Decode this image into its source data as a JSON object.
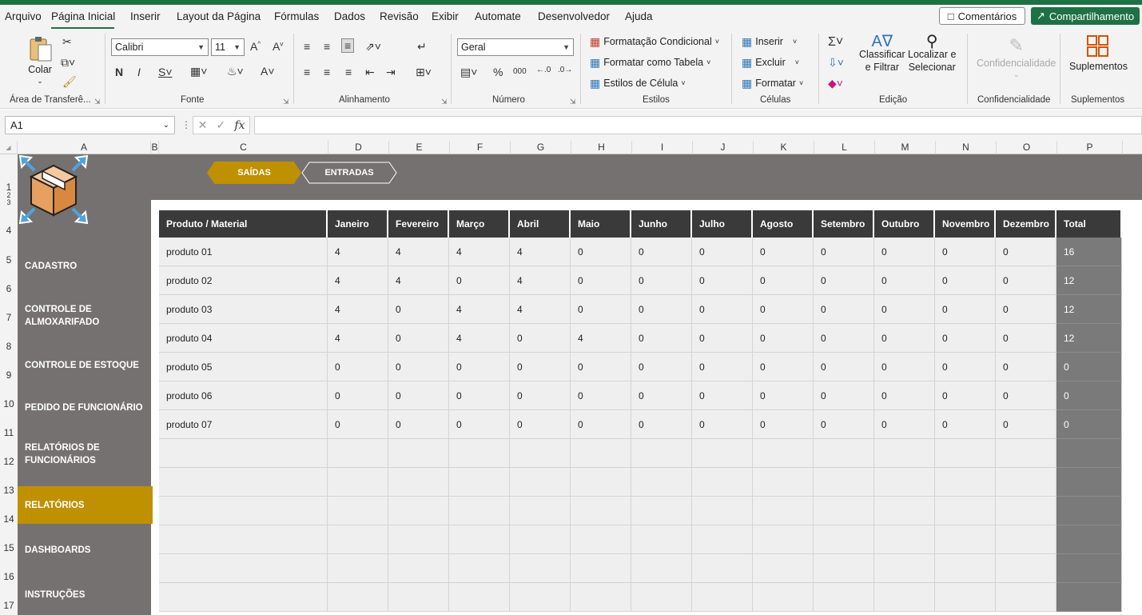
{
  "menu": {
    "items": [
      "Arquivo",
      "Página Inicial",
      "Inserir",
      "Layout da Página",
      "Fórmulas",
      "Dados",
      "Revisão",
      "Exibir",
      "Automate",
      "Desenvolvedor",
      "Ajuda"
    ],
    "comments": "Comentários",
    "share": "Compartilhamento"
  },
  "ribbon": {
    "clipboard": {
      "paste": "Colar",
      "group": "Área de Transferê..."
    },
    "font": {
      "name": "Calibri",
      "size": "11",
      "group": "Fonte"
    },
    "alignment": {
      "group": "Alinhamento"
    },
    "number": {
      "format": "Geral",
      "group": "Número"
    },
    "styles": {
      "cond_format": "Formatação Condicional",
      "format_table": "Formatar como Tabela",
      "cell_styles": "Estilos de Célula",
      "group": "Estilos"
    },
    "cells": {
      "insert": "Inserir",
      "delete": "Excluir",
      "format": "Formatar",
      "group": "Células"
    },
    "editing": {
      "sort_line1": "Classificar",
      "sort_line2": "e Filtrar",
      "find_line1": "Localizar e",
      "find_line2": "Selecionar",
      "group": "Edição"
    },
    "sensitivity": {
      "label": "Confidencialidade",
      "group": "Confidencialidade"
    },
    "addins": {
      "label": "Suplementos",
      "group": "Suplementos"
    }
  },
  "formula_bar": {
    "name_box": "A1",
    "fx": "fx",
    "formula": ""
  },
  "columns": [
    "A",
    "B",
    "C",
    "D",
    "E",
    "F",
    "G",
    "H",
    "I",
    "J",
    "K",
    "L",
    "M",
    "N",
    "O",
    "P"
  ],
  "rows": [
    "1",
    "2",
    "3",
    "4",
    "5",
    "6",
    "7",
    "8",
    "9",
    "10",
    "11",
    "12",
    "13",
    "14",
    "15",
    "16",
    "17"
  ],
  "tabs": {
    "outputs": "SAÍDAS",
    "inputs": "ENTRADAS"
  },
  "sidebar": {
    "items": [
      "CADASTRO",
      "CONTROLE DE ALMOXARIFADO",
      "CONTROLE DE ESTOQUE",
      "PEDIDO DE FUNCIONÁRIO",
      "RELATÓRIOS DE FUNCIONÁRIOS",
      "RELATÓRIOS",
      "DASHBOARDS",
      "INSTRUÇÕES"
    ],
    "active": "RELATÓRIOS"
  },
  "table": {
    "headers": [
      "Produto / Material",
      "Janeiro",
      "Fevereiro",
      "Março",
      "Abril",
      "Maio",
      "Junho",
      "Julho",
      "Agosto",
      "Setembro",
      "Outubro",
      "Novembro",
      "Dezembro",
      "Total"
    ],
    "rows": [
      [
        "produto 01",
        "4",
        "4",
        "4",
        "4",
        "0",
        "0",
        "0",
        "0",
        "0",
        "0",
        "0",
        "0",
        "16"
      ],
      [
        "produto 02",
        "4",
        "4",
        "0",
        "4",
        "0",
        "0",
        "0",
        "0",
        "0",
        "0",
        "0",
        "0",
        "12"
      ],
      [
        "produto 03",
        "4",
        "0",
        "4",
        "4",
        "0",
        "0",
        "0",
        "0",
        "0",
        "0",
        "0",
        "0",
        "12"
      ],
      [
        "produto 04",
        "4",
        "0",
        "4",
        "0",
        "4",
        "0",
        "0",
        "0",
        "0",
        "0",
        "0",
        "0",
        "12"
      ],
      [
        "produto 05",
        "0",
        "0",
        "0",
        "0",
        "0",
        "0",
        "0",
        "0",
        "0",
        "0",
        "0",
        "0",
        "0"
      ],
      [
        "produto 06",
        "0",
        "0",
        "0",
        "0",
        "0",
        "0",
        "0",
        "0",
        "0",
        "0",
        "0",
        "0",
        "0"
      ],
      [
        "produto 07",
        "0",
        "0",
        "0",
        "0",
        "0",
        "0",
        "0",
        "0",
        "0",
        "0",
        "0",
        "0",
        "0"
      ],
      [
        "",
        "",
        "",
        "",
        "",
        "",
        "",
        "",
        "",
        "",
        "",
        "",
        "",
        ""
      ],
      [
        "",
        "",
        "",
        "",
        "",
        "",
        "",
        "",
        "",
        "",
        "",
        "",
        "",
        ""
      ],
      [
        "",
        "",
        "",
        "",
        "",
        "",
        "",
        "",
        "",
        "",
        "",
        "",
        "",
        ""
      ],
      [
        "",
        "",
        "",
        "",
        "",
        "",
        "",
        "",
        "",
        "",
        "",
        "",
        "",
        ""
      ],
      [
        "",
        "",
        "",
        "",
        "",
        "",
        "",
        "",
        "",
        "",
        "",
        "",
        "",
        ""
      ],
      [
        "",
        "",
        "",
        "",
        "",
        "",
        "",
        "",
        "",
        "",
        "",
        "",
        "",
        ""
      ]
    ]
  },
  "colors": {
    "accent": "#bf9000",
    "sidebar": "#767171",
    "header": "#3a3a3a",
    "excel_green": "#1e7145"
  }
}
